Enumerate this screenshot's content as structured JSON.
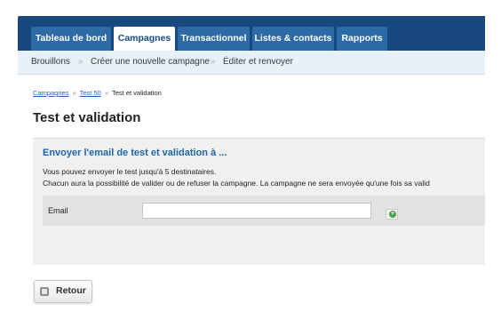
{
  "nav": {
    "tabs": [
      {
        "label": "Tableau de bord",
        "active": false
      },
      {
        "label": "Campagnes",
        "active": true
      },
      {
        "label": "Transactionnel",
        "active": false
      },
      {
        "label": "Listes & contacts",
        "active": false
      },
      {
        "label": "Rapports",
        "active": false
      }
    ]
  },
  "subnav": {
    "items": [
      "Brouillons",
      "Créer une nouvelle campagne",
      "Éditer et renvoyer"
    ],
    "separator": "»"
  },
  "breadcrumb": {
    "items": [
      "Campagnes",
      "Test 50",
      "Test et validation"
    ],
    "separator": "»"
  },
  "page": {
    "title": "Test et validation"
  },
  "panel": {
    "heading": "Envoyer l'email de test et validation à ...",
    "line1": "Vous pouvez envoyer le test jusqu'à 5 destinataires.",
    "line2": "Chacun aura la possibilité de valider ou de refuser la campagne. La campagne ne sera envoyée qu'une fois sa valid",
    "email_label": "Email",
    "email_value": ""
  },
  "actions": {
    "back_label": "Retour"
  },
  "colors": {
    "nav_bg": "#17497f",
    "tab_bg": "#2d6aa6",
    "heading_blue": "#1d66ad"
  }
}
